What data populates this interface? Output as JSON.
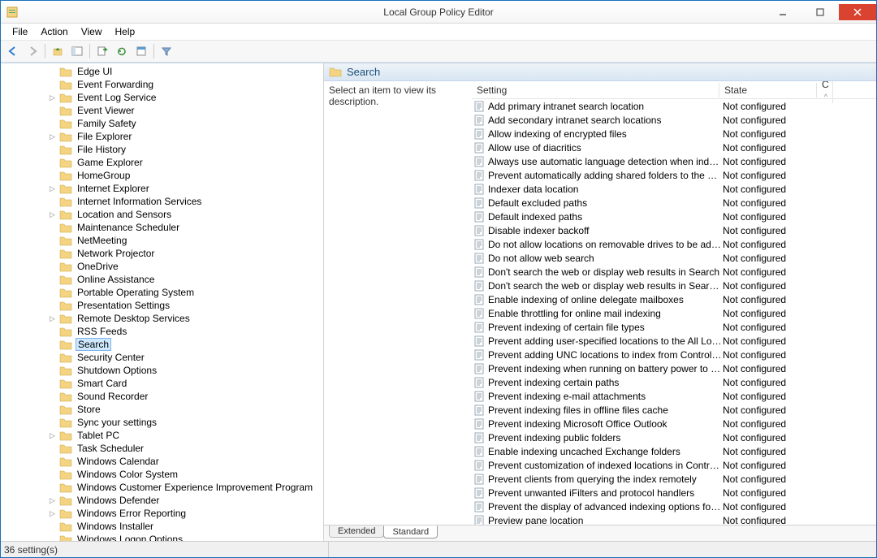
{
  "window": {
    "title": "Local Group Policy Editor"
  },
  "menu": {
    "file": "File",
    "action": "Action",
    "view": "View",
    "help": "Help"
  },
  "tree": {
    "items": [
      {
        "name": "Edge UI",
        "expander": ""
      },
      {
        "name": "Event Forwarding",
        "expander": ""
      },
      {
        "name": "Event Log Service",
        "expander": "▷"
      },
      {
        "name": "Event Viewer",
        "expander": ""
      },
      {
        "name": "Family Safety",
        "expander": ""
      },
      {
        "name": "File Explorer",
        "expander": "▷"
      },
      {
        "name": "File History",
        "expander": ""
      },
      {
        "name": "Game Explorer",
        "expander": ""
      },
      {
        "name": "HomeGroup",
        "expander": ""
      },
      {
        "name": "Internet Explorer",
        "expander": "▷"
      },
      {
        "name": "Internet Information Services",
        "expander": ""
      },
      {
        "name": "Location and Sensors",
        "expander": "▷"
      },
      {
        "name": "Maintenance Scheduler",
        "expander": ""
      },
      {
        "name": "NetMeeting",
        "expander": ""
      },
      {
        "name": "Network Projector",
        "expander": ""
      },
      {
        "name": "OneDrive",
        "expander": ""
      },
      {
        "name": "Online Assistance",
        "expander": ""
      },
      {
        "name": "Portable Operating System",
        "expander": ""
      },
      {
        "name": "Presentation Settings",
        "expander": ""
      },
      {
        "name": "Remote Desktop Services",
        "expander": "▷"
      },
      {
        "name": "RSS Feeds",
        "expander": ""
      },
      {
        "name": "Search",
        "expander": "",
        "selected": true
      },
      {
        "name": "Security Center",
        "expander": ""
      },
      {
        "name": "Shutdown Options",
        "expander": ""
      },
      {
        "name": "Smart Card",
        "expander": ""
      },
      {
        "name": "Sound Recorder",
        "expander": ""
      },
      {
        "name": "Store",
        "expander": ""
      },
      {
        "name": "Sync your settings",
        "expander": ""
      },
      {
        "name": "Tablet PC",
        "expander": "▷"
      },
      {
        "name": "Task Scheduler",
        "expander": ""
      },
      {
        "name": "Windows Calendar",
        "expander": ""
      },
      {
        "name": "Windows Color System",
        "expander": ""
      },
      {
        "name": "Windows Customer Experience Improvement Program",
        "expander": ""
      },
      {
        "name": "Windows Defender",
        "expander": "▷"
      },
      {
        "name": "Windows Error Reporting",
        "expander": "▷"
      },
      {
        "name": "Windows Installer",
        "expander": ""
      },
      {
        "name": "Windows Logon Options",
        "expander": ""
      }
    ]
  },
  "panel": {
    "title": "Search",
    "description": "Select an item to view its description.",
    "columns": {
      "setting": "Setting",
      "state": "State",
      "c": "C"
    },
    "settings": [
      {
        "name": "Add primary intranet search location",
        "state": "Not configured"
      },
      {
        "name": "Add secondary intranet search locations",
        "state": "Not configured"
      },
      {
        "name": "Allow indexing of encrypted files",
        "state": "Not configured"
      },
      {
        "name": "Allow use of diacritics",
        "state": "Not configured"
      },
      {
        "name": "Always use automatic language detection when indexing co...",
        "state": "Not configured"
      },
      {
        "name": "Prevent automatically adding shared folders to the Windo...",
        "state": "Not configured"
      },
      {
        "name": "Indexer data location",
        "state": "Not configured"
      },
      {
        "name": "Default excluded paths",
        "state": "Not configured"
      },
      {
        "name": "Default indexed paths",
        "state": "Not configured"
      },
      {
        "name": "Disable indexer backoff",
        "state": "Not configured"
      },
      {
        "name": "Do not allow locations on removable drives to be added to li...",
        "state": "Not configured"
      },
      {
        "name": "Do not allow web search",
        "state": "Not configured"
      },
      {
        "name": "Don't search the web or display web results in Search",
        "state": "Not configured"
      },
      {
        "name": "Don't search the web or display web results in Search over ...",
        "state": "Not configured"
      },
      {
        "name": "Enable indexing of online delegate mailboxes",
        "state": "Not configured"
      },
      {
        "name": "Enable throttling for online mail indexing",
        "state": "Not configured"
      },
      {
        "name": "Prevent indexing of certain file types",
        "state": "Not configured"
      },
      {
        "name": "Prevent adding user-specified locations to the All Locations ...",
        "state": "Not configured"
      },
      {
        "name": "Prevent adding UNC locations to index from Control Panel",
        "state": "Not configured"
      },
      {
        "name": "Prevent indexing when running on battery power to conserv...",
        "state": "Not configured"
      },
      {
        "name": "Prevent indexing certain paths",
        "state": "Not configured"
      },
      {
        "name": "Prevent indexing e-mail attachments",
        "state": "Not configured"
      },
      {
        "name": "Prevent indexing files in offline files cache",
        "state": "Not configured"
      },
      {
        "name": "Prevent indexing Microsoft Office Outlook",
        "state": "Not configured"
      },
      {
        "name": "Prevent indexing public folders",
        "state": "Not configured"
      },
      {
        "name": "Enable indexing uncached Exchange folders",
        "state": "Not configured"
      },
      {
        "name": "Prevent customization of indexed locations in Control Panel",
        "state": "Not configured"
      },
      {
        "name": "Prevent clients from querying the index remotely",
        "state": "Not configured"
      },
      {
        "name": "Prevent unwanted iFilters and protocol handlers",
        "state": "Not configured"
      },
      {
        "name": "Prevent the display of advanced indexing options for Windo...",
        "state": "Not configured"
      },
      {
        "name": "Preview pane location",
        "state": "Not configured"
      }
    ]
  },
  "tabs": {
    "extended": "Extended",
    "standard": "Standard"
  },
  "statusbar": {
    "text": "36 setting(s)"
  }
}
